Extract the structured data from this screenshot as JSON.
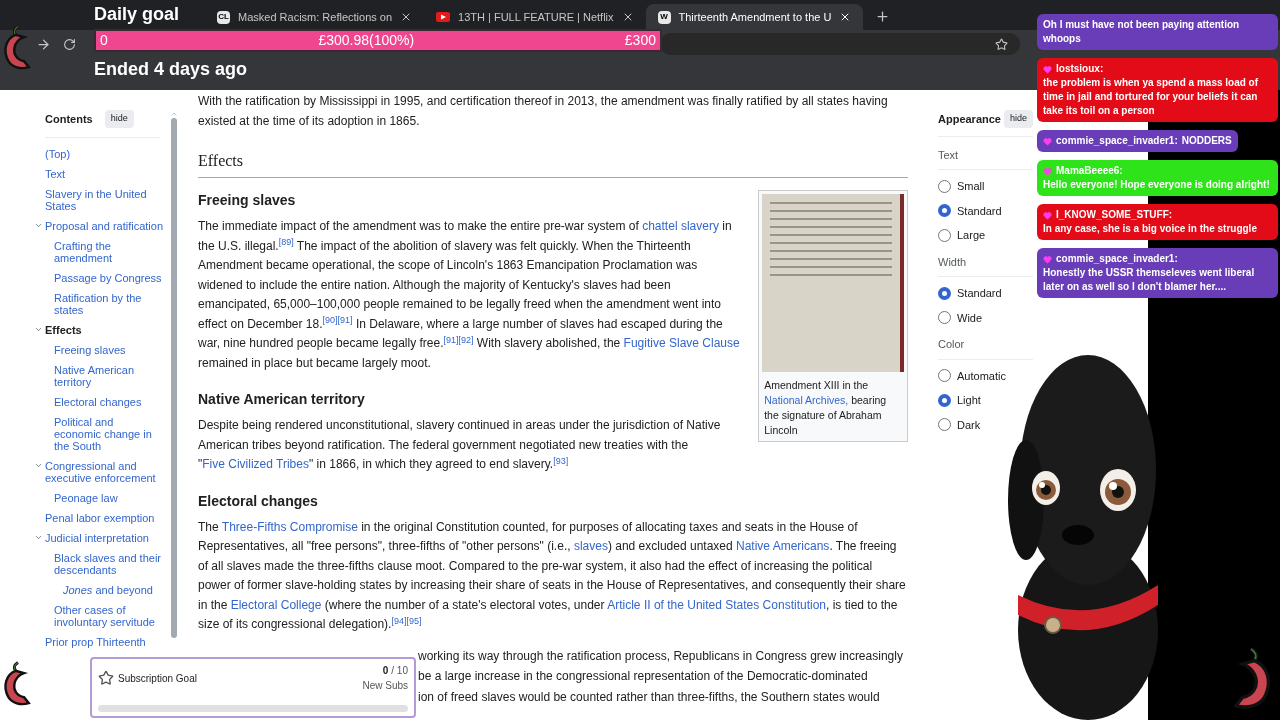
{
  "browser": {
    "tabs": [
      {
        "title": "Masked Racism: Reflections on",
        "favicon_text": "CL",
        "selected": false
      },
      {
        "title": "13TH | FULL FEATURE | Netflix",
        "selected": false
      },
      {
        "title": "Thirteenth Amendment to the U",
        "favicon_text": "W",
        "selected": true
      }
    ]
  },
  "daily_goal": {
    "title": "Daily goal",
    "start": "0",
    "progress": "£300.98(100%)",
    "target": "£300",
    "level": 1,
    "status": "Ended 4 days ago"
  },
  "contents": {
    "title": "Contents",
    "hide": "hide",
    "items": [
      {
        "label": "(Top)",
        "selected": false
      },
      {
        "label": "Text",
        "selected": false
      },
      {
        "label": "Slavery in the United States",
        "selected": false
      },
      {
        "label": "Proposal and ratification",
        "selected": false,
        "expanded": true,
        "children": [
          {
            "label": "Crafting the amendment",
            "selected": false
          },
          {
            "label": "Passage by Congress",
            "selected": false
          },
          {
            "label": "Ratification by the states",
            "selected": false
          }
        ]
      },
      {
        "label": "Effects",
        "selected": true,
        "expanded": true,
        "children": [
          {
            "label": "Freeing slaves",
            "selected": false
          },
          {
            "label": "Native American territory",
            "selected": false
          },
          {
            "label": "Electoral changes",
            "selected": false
          },
          {
            "label": "Political and economic change in the South",
            "selected": false
          }
        ]
      },
      {
        "label": "Congressional and executive enforcement",
        "selected": false,
        "expanded": true,
        "children": [
          {
            "label": "Peonage law",
            "selected": false
          }
        ]
      },
      {
        "label": "Penal labor exemption",
        "selected": false
      },
      {
        "label": "Judicial interpretation",
        "selected": false,
        "expanded": true,
        "children": [
          {
            "label": "Black slaves and their descendants",
            "selected": false,
            "children": [
              {
                "label": "*Jones* and beyond",
                "selected": false
              }
            ]
          },
          {
            "label": "Other cases of involuntary servitude",
            "selected": false
          }
        ]
      },
      {
        "label": "Prior prop Thirteenth",
        "selected": false
      }
    ]
  },
  "article": {
    "intro": [
      {
        "kind": "text",
        "text": "With the ratification by Mississippi in 1995, and certification thereof in 2013, the amendment was finally ratified by all states having existed at the time of its adoption in 1865."
      }
    ],
    "section_title": "Effects",
    "subsections": [
      {
        "title": "Freeing slaves",
        "paragraph": [
          {
            "kind": "text",
            "text": "The immediate impact of the amendment was to make the entire pre-war system of "
          },
          {
            "kind": "link",
            "text": "chattel slavery"
          },
          {
            "kind": "text",
            "text": " in the U.S. illegal."
          },
          {
            "kind": "ref",
            "text": "[89]"
          },
          {
            "kind": "text",
            "text": " The impact of the abolition of slavery was felt quickly. When the Thirteenth Amendment became operational, the scope of Lincoln's 1863 Emancipation Proclamation was widened to include the entire nation. Although the majority of Kentucky's slaves had been emancipated, 65,000–100,000 people remained to be legally freed when the amendment went into effect on December 18."
          },
          {
            "kind": "ref",
            "text": "[90]"
          },
          {
            "kind": "ref",
            "text": "[91]"
          },
          {
            "kind": "text",
            "text": " In Delaware, where a large number of slaves had escaped during the war, nine hundred people became legally free."
          },
          {
            "kind": "ref",
            "text": "[91]"
          },
          {
            "kind": "ref",
            "text": "[92]"
          },
          {
            "kind": "text",
            "text": " With slavery abolished, the "
          },
          {
            "kind": "link",
            "text": "Fugitive Slave Clause"
          },
          {
            "kind": "text",
            "text": " remained in place but became largely moot."
          }
        ],
        "figure": {
          "caption": [
            {
              "kind": "text",
              "text": "Amendment XIII in the "
            },
            {
              "kind": "link",
              "text": "National Archives,"
            },
            {
              "kind": "text",
              "text": " bearing the signature of Abraham Lincoln"
            }
          ]
        }
      },
      {
        "title": "Native American territory",
        "paragraph": [
          {
            "kind": "text",
            "text": "Despite being rendered unconstitutional, slavery continued in areas under the jurisdiction of Native American tribes beyond ratification. The federal government negotiated new treaties with the \""
          },
          {
            "kind": "link",
            "text": "Five Civilized Tribes"
          },
          {
            "kind": "text",
            "text": "\" in 1866, in which they agreed to end slavery."
          },
          {
            "kind": "ref",
            "text": "[93]"
          }
        ]
      },
      {
        "title": "Electoral changes",
        "paragraph": [
          {
            "kind": "text",
            "text": "The "
          },
          {
            "kind": "link",
            "text": "Three-Fifths Compromise"
          },
          {
            "kind": "text",
            "text": " in the original Constitution counted, for purposes of allocating taxes and seats in the House of Representatives, all \"free persons\", three-fifths of \"other persons\" (i.e., "
          },
          {
            "kind": "link",
            "text": "slaves"
          },
          {
            "kind": "text",
            "text": ") and excluded untaxed "
          },
          {
            "kind": "link",
            "text": "Native Americans"
          },
          {
            "kind": "text",
            "text": ". The freeing of all slaves made the three-fifths clause moot. Compared to the pre-war system, it also had the effect of increasing the political power of former slave-holding states by increasing their share of seats in the House of Representatives, and consequently their share in the "
          },
          {
            "kind": "link",
            "text": "Electoral College"
          },
          {
            "kind": "text",
            "text": " (where the number of a state's electoral votes, under "
          },
          {
            "kind": "link",
            "text": "Article II of the United States Constitution"
          },
          {
            "kind": "text",
            "text": ", is tied to the size of its congressional delegation)."
          },
          {
            "kind": "ref",
            "text": "[94]"
          },
          {
            "kind": "ref",
            "text": "[95]"
          }
        ]
      }
    ],
    "partial_lines": [
      "working its way through the ratification process, Republicans in Congress grew increasingly",
      "be a large increase in the congressional representation of the Democratic-dominated",
      "ion of freed slaves would be counted rather than three-fifths, the Southern states would"
    ]
  },
  "appearance": {
    "title": "Appearance",
    "hide": "hide",
    "groups": [
      {
        "label": "Text",
        "options": [
          {
            "label": "Small",
            "selected": false
          },
          {
            "label": "Standard",
            "selected": true
          },
          {
            "label": "Large",
            "selected": false
          }
        ]
      },
      {
        "label": "Width",
        "options": [
          {
            "label": "Standard",
            "selected": true
          },
          {
            "label": "Wide",
            "selected": false
          }
        ]
      },
      {
        "label": "Color",
        "options": [
          {
            "label": "Automatic",
            "selected": false
          },
          {
            "label": "Light",
            "selected": true
          },
          {
            "label": "Dark",
            "selected": false
          }
        ]
      }
    ]
  },
  "chat": [
    {
      "kind": "continuation",
      "color": "#6a3db8",
      "text": "Oh I must have not been paying attention whoops"
    },
    {
      "kind": "block",
      "color": "#e30b17",
      "user": "lostsioux:",
      "text": "the problem is when ya spend a mass load of time in jail and tortured for your beliefs it can take its toil on a person"
    },
    {
      "kind": "inline",
      "color": "#6a3db8",
      "user": "commie_space_invader1:",
      "text": "NODDERS"
    },
    {
      "kind": "block",
      "color": "#2fe31b",
      "user": "MamaBeeee6:",
      "text": "Hello everyone! Hope everyone is doing alright!"
    },
    {
      "kind": "block",
      "color": "#e30b17",
      "user": "I_KNOW_SOME_STUFF:",
      "text": "In any case, she is a big voice in the struggle"
    },
    {
      "kind": "block",
      "color": "#6a3db8",
      "user": "commie_space_invader1:",
      "text": "Honestly the USSR themseleves went liberal later on as well so I don't blamer her...."
    }
  ],
  "subscription_goal": {
    "title": "Subscription Goal",
    "count": "0",
    "total": "/ 10",
    "caption": "New Subs"
  }
}
